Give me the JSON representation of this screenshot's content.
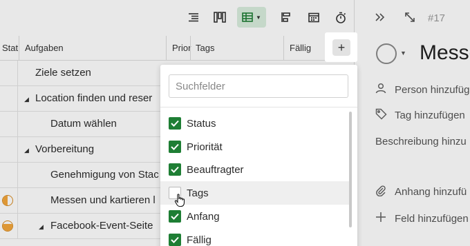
{
  "colors": {
    "accent": "#1e7e34",
    "table_view_bg": "#d9eedd",
    "status_orange": "#f4a63a"
  },
  "toolbar": {
    "icons": [
      "list-icon",
      "board-icon",
      "table-icon",
      "gantt-icon",
      "calendar-icon",
      "timer-icon"
    ],
    "active_view": "table-icon"
  },
  "header": {
    "col_status": "Stat",
    "col_tasks": "Aufgaben",
    "col_priority": "Prior",
    "col_tags": "Tags",
    "col_due": "Fällig"
  },
  "rows": [
    {
      "label": "Ziele setzen"
    },
    {
      "label": "Location finden und reser"
    },
    {
      "label": "Datum wählen"
    },
    {
      "label": "Vorbereitung"
    },
    {
      "label": "Genehmigung von Stac"
    },
    {
      "label": "Messen und kartieren l"
    },
    {
      "label": "Facebook-Event-Seite"
    }
  ],
  "detail": {
    "task_number": "#17",
    "title": "Messe",
    "assignee": "Person hinzufüg",
    "tag": "Tag hinzufügen",
    "description": "Beschreibung hinzu",
    "attachment": "Anhang hinzufü",
    "add_field": "Feld hinzufügen"
  },
  "add_button": {
    "label": "+"
  },
  "field_menu": {
    "search_placeholder": "Suchfelder",
    "options": [
      {
        "label": "Status",
        "checked": true
      },
      {
        "label": "Priorität",
        "checked": true
      },
      {
        "label": "Beauftragter",
        "checked": true
      },
      {
        "label": "Tags",
        "checked": false
      },
      {
        "label": "Anfang",
        "checked": true
      },
      {
        "label": "Fällig",
        "checked": true
      }
    ]
  }
}
